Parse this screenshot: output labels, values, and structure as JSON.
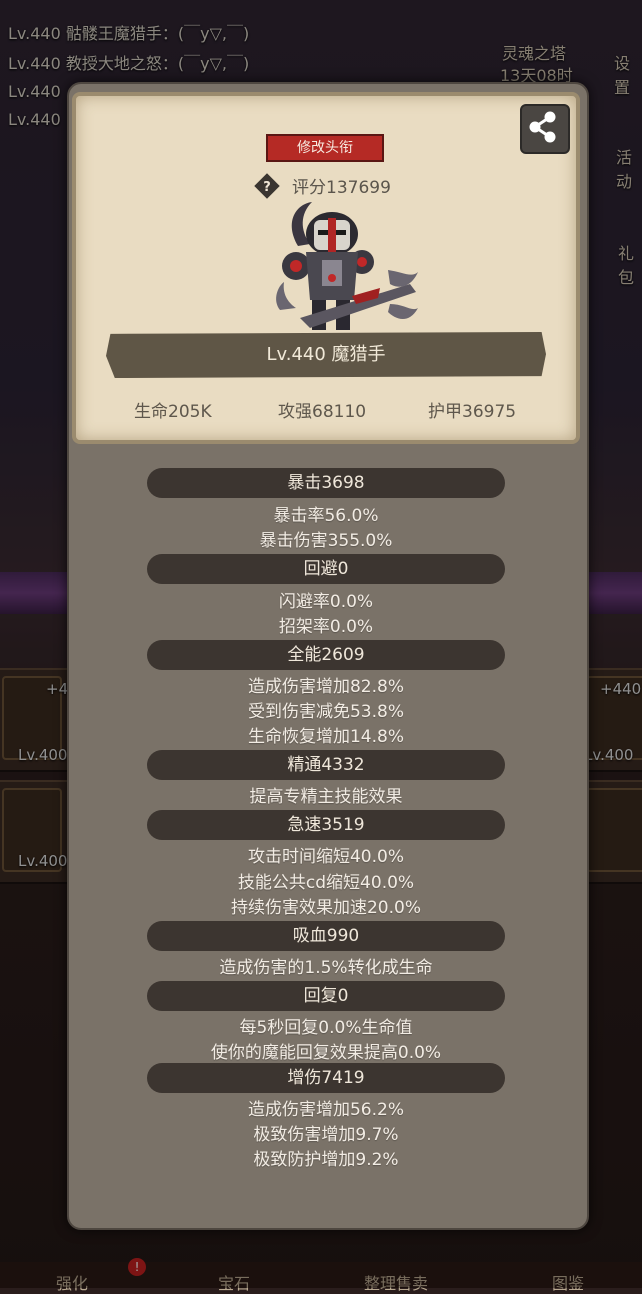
{
  "background": {
    "chat": [
      "Lv.440 骷髅王魔猎手：(￣y▽,￣)",
      "Lv.440 教授大地之怒：(￣y▽,￣)",
      "Lv.440",
      "Lv.440"
    ],
    "soul_tower": "灵魂之塔",
    "timer": "13天08时",
    "settings": "设置",
    "activity": "活动",
    "gift": "礼包",
    "side_left_plus": "+4",
    "side_right_plus": "+440",
    "side_lv_left_1": "Lv.400",
    "side_lv_left_2": "Lv.400",
    "side_lv_right_1": "Lv.400",
    "tabs": [
      "强化",
      "宝石",
      "整理售卖",
      "图鉴"
    ],
    "tab_badge": "!"
  },
  "profile": {
    "title_button": "修改头衔",
    "score": "评分137699",
    "name": "Lv.440 魔猎手",
    "hp": "生命205K",
    "attack": "攻强68110",
    "armor": "护甲36975"
  },
  "stats": [
    {
      "header": "暴击3698",
      "lines": [
        "暴击率56.0%",
        "暴击伤害355.0%"
      ]
    },
    {
      "header": "回避0",
      "lines": [
        "闪避率0.0%",
        "招架率0.0%"
      ]
    },
    {
      "header": "全能2609",
      "lines": [
        "造成伤害增加82.8%",
        "受到伤害减免53.8%",
        "生命恢复增加14.8%"
      ]
    },
    {
      "header": "精通4332",
      "lines": [
        "提高专精主技能效果"
      ]
    },
    {
      "header": "急速3519",
      "lines": [
        "攻击时间缩短40.0%",
        "技能公共cd缩短40.0%",
        "持续伤害效果加速20.0%"
      ]
    },
    {
      "header": "吸血990",
      "lines": [
        "造成伤害的1.5%转化成生命"
      ]
    },
    {
      "header": "回复0",
      "lines": [
        "每5秒回复0.0%生命值",
        "使你的魔能回复效果提高0.0%"
      ]
    },
    {
      "header": "增伤7419",
      "lines": [
        "造成伤害增加56.2%",
        "极致伤害增加9.7%",
        "极致防护增加9.2%"
      ]
    }
  ]
}
